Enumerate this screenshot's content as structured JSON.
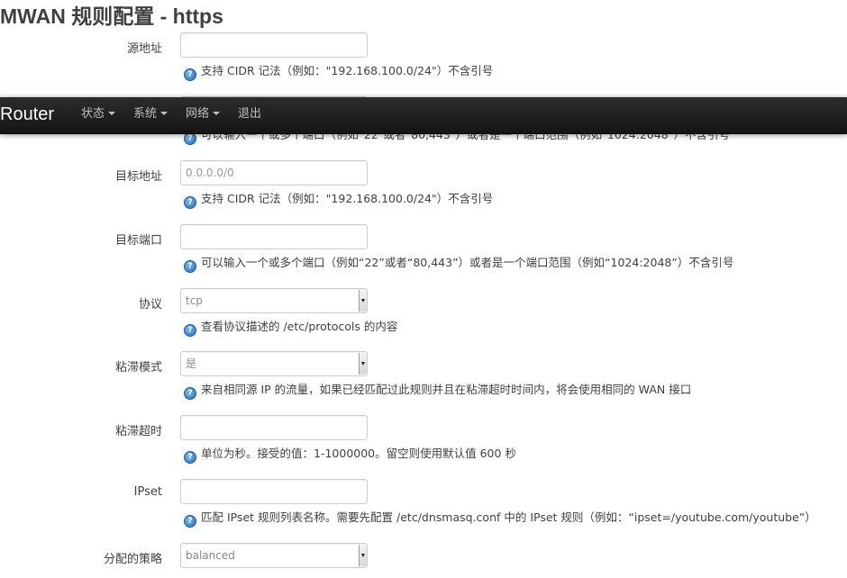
{
  "page_title": "MWAN 规则配置 - https",
  "navbar": {
    "brand": "Router",
    "menu": [
      {
        "label": "状态"
      },
      {
        "label": "系统"
      },
      {
        "label": "网络"
      },
      {
        "label": "退出"
      }
    ]
  },
  "fields": {
    "src_ip": {
      "label": "源地址",
      "value": "",
      "placeholder": "",
      "help": "支持 CIDR 记法（例如：\"192.168.100.0/24\"）不含引号"
    },
    "src_port": {
      "help": "可以输入一个或多个端口（例如\"22\"或者\"80,443\"）或者是一个端口范围（例如\"1024:2048\"）不含引号"
    },
    "dest_ip": {
      "label": "目标地址",
      "value": "",
      "placeholder": "0.0.0.0/0",
      "help": "支持 CIDR 记法（例如：\"192.168.100.0/24\"）不含引号"
    },
    "dest_port": {
      "label": "目标端口",
      "value": "",
      "placeholder": "",
      "help": "可以输入一个或多个端口（例如“22”或者“80,443”）或者是一个端口范围（例如“1024:2048”）不含引号"
    },
    "proto": {
      "label": "协议",
      "value": "tcp",
      "help": "查看协议描述的 /etc/protocols 的内容"
    },
    "sticky": {
      "label": "粘滞模式",
      "value": "是",
      "help": "来自相同源 IP 的流量，如果已经匹配过此规则并且在粘滞超时时间内，将会使用相同的 WAN 接口"
    },
    "timeout": {
      "label": "粘滞超时",
      "value": "",
      "placeholder": "",
      "help": "单位为秒。接受的值：1-1000000。留空则使用默认值 600 秒"
    },
    "ipset": {
      "label": "IPset",
      "value": "",
      "placeholder": "",
      "help": "匹配 IPset 规则列表名称。需要先配置 /etc/dnsmasq.conf 中的 IPset 规则（例如：“ipset=/youtube.com/youtube”）"
    },
    "policy": {
      "label": "分配的策略",
      "value": "balanced"
    }
  },
  "colors": {
    "navbar_bg": "#1b1b1b",
    "nav_text": "#bfbfbf",
    "help_icon": "#2a6fb8"
  },
  "icons": {
    "help": "help-icon",
    "dropdown": "caret-down-icon"
  }
}
